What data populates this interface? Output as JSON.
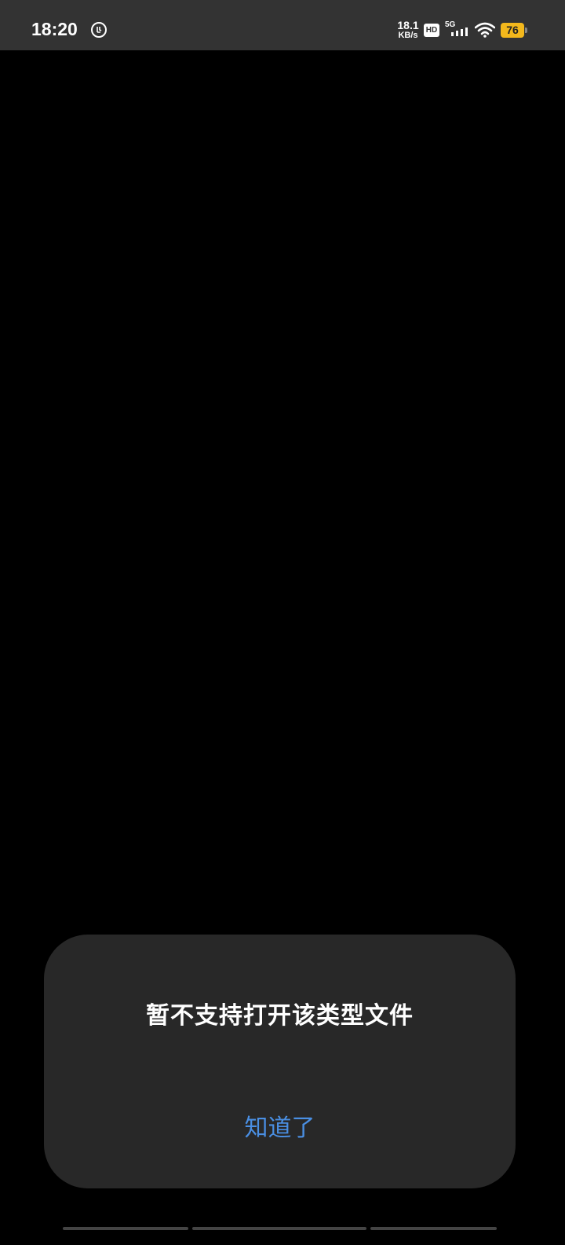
{
  "status_bar": {
    "time": "18:20",
    "net_speed_value": "18.1",
    "net_speed_unit": "KB/s",
    "hd_label": "HD",
    "signal_label": "5G",
    "battery_level": "76",
    "battery_color": "#f3b81c"
  },
  "dialog": {
    "message": "暂不支持打开该类型文件",
    "confirm_label": "知道了",
    "accent_color": "#4a8fe3"
  }
}
